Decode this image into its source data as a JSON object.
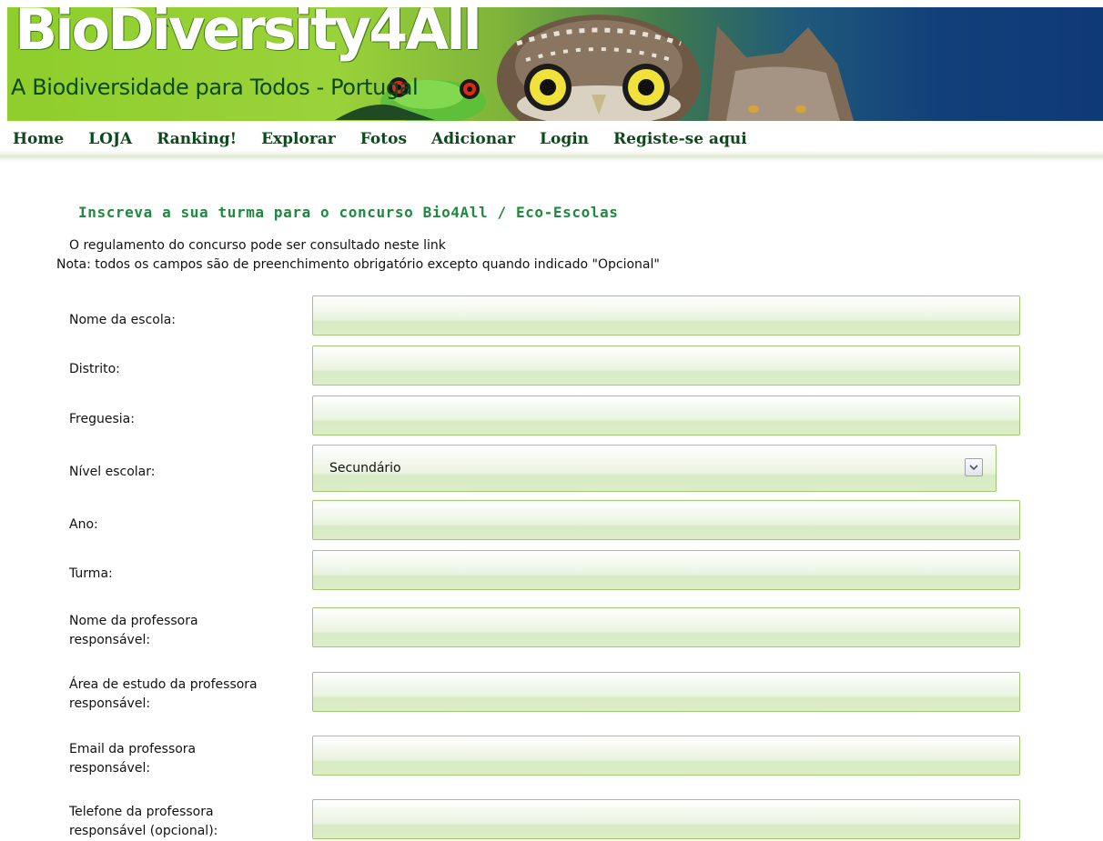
{
  "banner": {
    "logo_text": "BioDiversity4All",
    "tagline": "A Biodiversidade para Todos - Portugal"
  },
  "nav": {
    "items": [
      "Home",
      "LOJA",
      "Ranking!",
      "Explorar",
      "Fotos",
      "Adicionar",
      "Login",
      "Registe-se aqui"
    ]
  },
  "form": {
    "title": "Inscreva a sua turma para o concurso Bio4All / Eco-Escolas",
    "info_line1": "O regulamento do concurso pode ser consultado neste link",
    "info_line2": "Nota: todos os campos são de preenchimento obrigatório excepto quando indicado \"Opcional\"",
    "fields": {
      "school_name": {
        "label": "Nome da escola:",
        "value": ""
      },
      "district": {
        "label": "Distrito:",
        "value": ""
      },
      "parish": {
        "label": "Freguesia:",
        "value": ""
      },
      "school_level": {
        "label": "Nível escolar:",
        "value": "Secundário"
      },
      "year": {
        "label": "Ano:",
        "value": ""
      },
      "class": {
        "label": "Turma:",
        "value": ""
      },
      "teacher_name": {
        "label_l1": "Nome da professora",
        "label_l2": "responsável:",
        "value": ""
      },
      "teacher_area": {
        "label_l1": "Área de estudo da professora",
        "label_l2": "responsável:",
        "value": ""
      },
      "teacher_email": {
        "label_l1": "Email da professora",
        "label_l2": "responsável:",
        "value": ""
      },
      "teacher_phone": {
        "label_l1": "Telefone da professora",
        "label_l2": "responsável (opcional):",
        "value": ""
      }
    }
  },
  "colors": {
    "brand_green": "#8fce2c",
    "nav_text": "#0b4a1a",
    "title_green": "#1d8a3e",
    "field_border": "#9ccb6f"
  }
}
